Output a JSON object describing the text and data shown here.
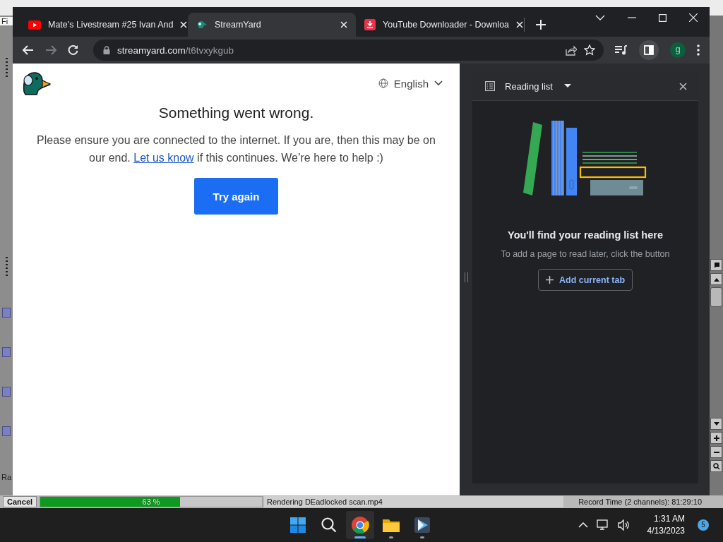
{
  "background_app": {
    "menu_text": "Fi",
    "side_text": "Ra",
    "cancel_button": "Cancel",
    "render_progress": {
      "level": 0.63,
      "reading": "63 %"
    },
    "status": "Rendering DEadlocked scan.mp4",
    "record_time": "Record Time (2 channels): 81:29:10"
  },
  "browser": {
    "tabs": [
      {
        "title": "Mate's Livestream #25 Ivan And",
        "selected": false,
        "kind": "youtube"
      },
      {
        "title": "StreamYard",
        "selected": true,
        "kind": "streamyard"
      },
      {
        "title": "YouTube Downloader - Downloa",
        "selected": false,
        "kind": "downloader"
      }
    ],
    "address": {
      "host": "streamyard.com",
      "path": "/t6tvxykgub"
    },
    "profile": "g",
    "side_panel_open": true
  },
  "page": {
    "language": "English",
    "heading": "Something went wrong.",
    "message_before": "Please ensure you are connected to the internet. If you are, then this may be on our end.",
    "link": "Let us know",
    "message_after": "if this continues. We’re here to help :)",
    "button": "Try again"
  },
  "reading_list": {
    "title": "Reading list",
    "empty_title": "You'll find your reading list here",
    "empty_hint": "To add a page to read later, click the button",
    "add_button": "Add current tab"
  },
  "taskbar": {
    "apps": [
      {
        "kind": "chrome",
        "selected": true
      },
      {
        "kind": "explorer",
        "selected": false
      },
      {
        "kind": "vegas",
        "selected": false
      }
    ],
    "time": "1:31 AM",
    "date": "4/13/2023",
    "notifications": "5"
  }
}
